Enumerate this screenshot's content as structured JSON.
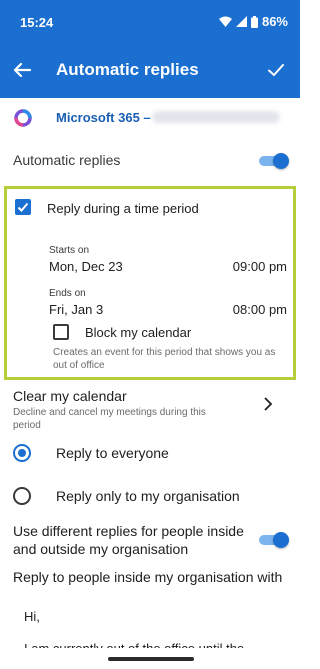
{
  "status": {
    "time": "15:24",
    "battery": "86%"
  },
  "appbar": {
    "title": "Automatic replies"
  },
  "account": {
    "name": "Microsoft 365 –"
  },
  "automatic_replies": {
    "label": "Automatic replies",
    "enabled": true
  },
  "time_period": {
    "label": "Reply during a time period",
    "checked": true,
    "starts_label": "Starts on",
    "start_date": "Mon, Dec 23",
    "start_time": "09:00 pm",
    "ends_label": "Ends on",
    "end_date": "Fri, Jan 3",
    "end_time": "08:00 pm",
    "block_label": "Block my calendar",
    "block_checked": false,
    "block_desc": "Creates an event for this period that shows you as out of office"
  },
  "clear_calendar": {
    "title": "Clear my calendar",
    "desc": "Decline and cancel my meetings during this period"
  },
  "audience": {
    "options": [
      "Reply to everyone",
      "Reply only to my organisation"
    ],
    "selected": "Reply to everyone"
  },
  "different_replies": {
    "label": "Use different replies for people inside and outside my organisation",
    "enabled": true
  },
  "inside_label": "Reply to people inside my organisation with",
  "message": {
    "greeting": "Hi,",
    "body": "I am currently out of the office until the"
  },
  "colors": {
    "primary": "#1a6fd0",
    "highlight_border": "#b5cf3b"
  }
}
